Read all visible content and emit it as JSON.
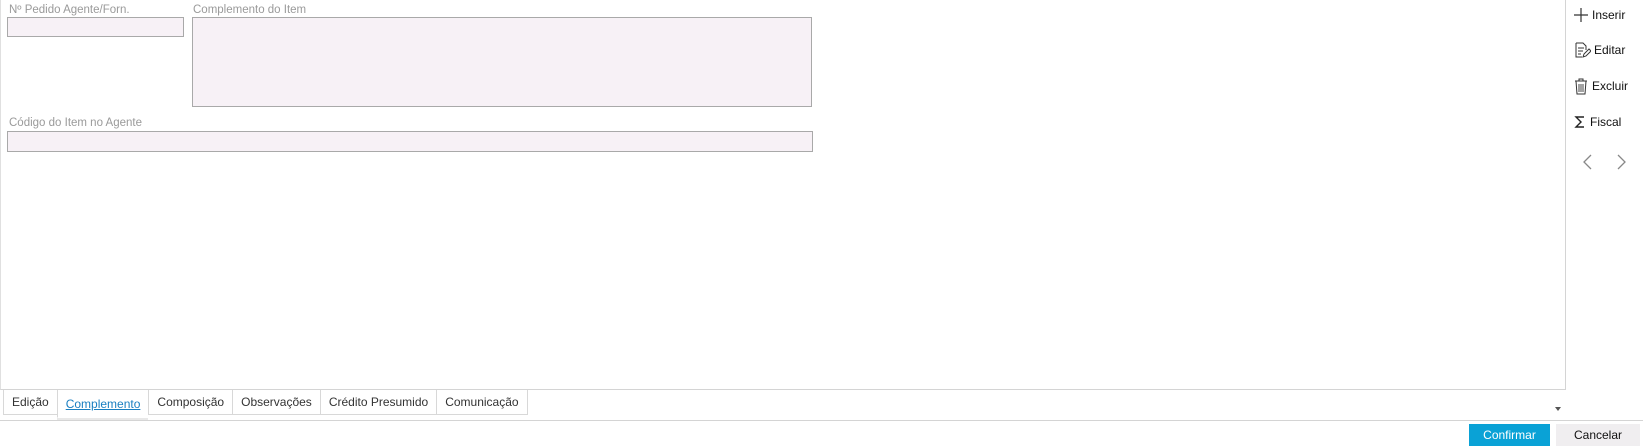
{
  "form": {
    "pedido_label": "Nº Pedido Agente/Forn.",
    "pedido_value": "",
    "complemento_label": "Complemento do Item",
    "complemento_value": "",
    "codigo_label": "Código do Item no Agente",
    "codigo_value": ""
  },
  "toolbar": {
    "inserir": "Inserir",
    "editar": "Editar",
    "excluir": "Excluir",
    "fiscal": "Fiscal"
  },
  "tabs": [
    {
      "label": "Edição",
      "active": false
    },
    {
      "label": "Complemento",
      "active": true
    },
    {
      "label": "Composição",
      "active": false
    },
    {
      "label": "Observações",
      "active": false
    },
    {
      "label": "Crédito Presumido",
      "active": false
    },
    {
      "label": "Comunicação",
      "active": false
    }
  ],
  "footer": {
    "confirm": "Confirmar",
    "cancel": "Cancelar"
  },
  "colors": {
    "accent": "#0aa2d6",
    "field_bg": "#f7f1f6",
    "active_tab": "#1a7fc1"
  }
}
